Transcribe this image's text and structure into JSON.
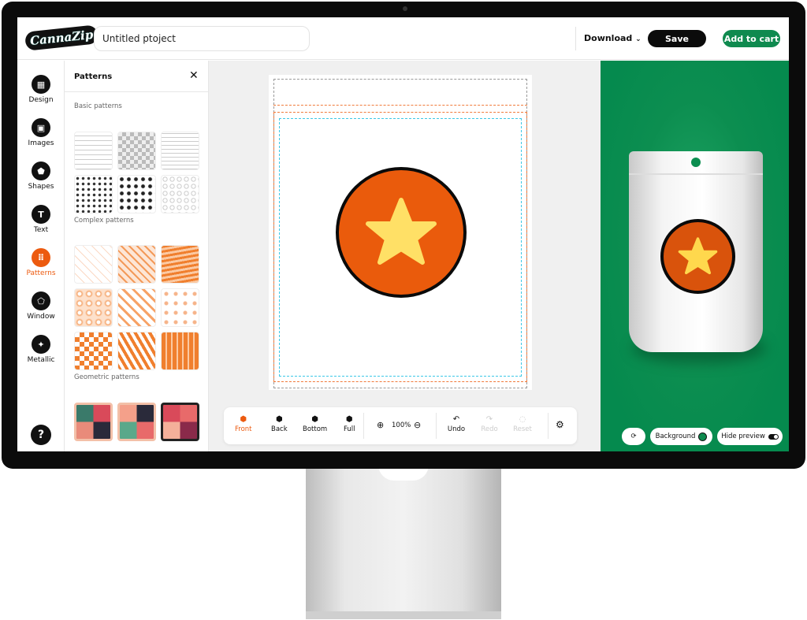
{
  "header": {
    "logo": "CannaZip",
    "project_title": "Untitled ptoject",
    "download_label": "Download",
    "save_label": "Save",
    "add_to_cart_label": "Add to cart"
  },
  "rail": {
    "items": [
      {
        "label": "Design",
        "icon": "grid-icon",
        "glyph": "▦"
      },
      {
        "label": "Images",
        "icon": "image-icon",
        "glyph": "▣"
      },
      {
        "label": "Shapes",
        "icon": "pentagon-icon",
        "glyph": "⬟"
      },
      {
        "label": "Text",
        "icon": "text-icon",
        "glyph": "T"
      },
      {
        "label": "Patterns",
        "icon": "dots-grid-icon",
        "glyph": "⠿",
        "active": true
      },
      {
        "label": "Window",
        "icon": "window-icon",
        "glyph": "⬠"
      },
      {
        "label": "Metallic",
        "icon": "sparkle-icon",
        "glyph": "✦"
      }
    ],
    "help_glyph": "?"
  },
  "panel": {
    "title": "Patterns",
    "close_glyph": "✕",
    "sections": [
      {
        "label": "Basic patterns"
      },
      {
        "label": "Complex patterns"
      },
      {
        "label": "Geometric patterns"
      }
    ]
  },
  "toolbar": {
    "views": [
      {
        "label": "Front",
        "active": true
      },
      {
        "label": "Back"
      },
      {
        "label": "Bottom"
      },
      {
        "label": "Full"
      }
    ],
    "zoom_level": "100%",
    "undo_label": "Undo",
    "redo_label": "Redo",
    "reset_label": "Reset"
  },
  "preview": {
    "background_label": "Background",
    "background_color": "#0f8a4f",
    "hide_preview_label": "Hide preview"
  },
  "colors": {
    "accent": "#ec5a0f",
    "brand_green": "#0f8a4f",
    "star": "#ffe066"
  }
}
